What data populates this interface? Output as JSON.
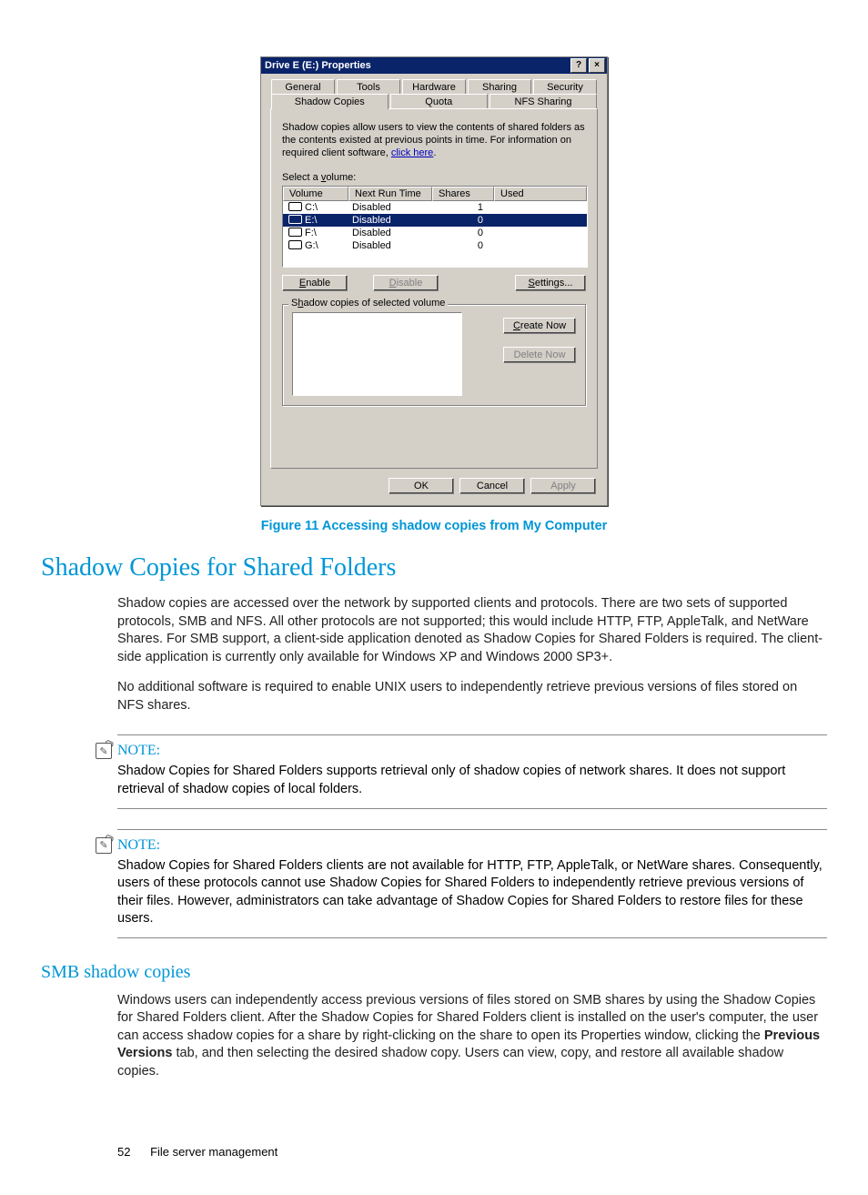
{
  "dialog": {
    "title": "Drive E (E:) Properties",
    "help_btn": "?",
    "close_btn": "×",
    "tabs_top": [
      "General",
      "Tools",
      "Hardware",
      "Sharing",
      "Security"
    ],
    "tabs_bottom": [
      "Shadow Copies",
      "Quota",
      "NFS Sharing"
    ],
    "desc_prefix": "Shadow copies allow users to view the contents of shared folders as the contents existed at previous points in time. For information on required client software, ",
    "desc_link": "click here",
    "desc_suffix": ".",
    "select_label_pre": "Select a ",
    "select_label_u": "v",
    "select_label_post": "olume:",
    "headers": {
      "volume": "Volume",
      "next_run": "Next Run Time",
      "shares": "Shares",
      "used": "Used"
    },
    "rows": [
      {
        "name": "C:\\",
        "next_run": "Disabled",
        "shares": "1",
        "used": ""
      },
      {
        "name": "E:\\",
        "next_run": "Disabled",
        "shares": "0",
        "used": "",
        "selected": true
      },
      {
        "name": "F:\\",
        "next_run": "Disabled",
        "shares": "0",
        "used": ""
      },
      {
        "name": "G:\\",
        "next_run": "Disabled",
        "shares": "0",
        "used": ""
      }
    ],
    "enable_btn_u": "E",
    "enable_btn_post": "nable",
    "disable_btn_u": "D",
    "disable_btn_post": "isable",
    "settings_btn_u": "S",
    "settings_btn_post": "ettings...",
    "fieldset_pre": "S",
    "fieldset_u": "h",
    "fieldset_post": "adow copies of selected volume",
    "create_btn_u": "C",
    "create_btn_post": "reate Now",
    "delete_btn": "Delete Now",
    "ok": "OK",
    "cancel": "Cancel",
    "apply": "Apply"
  },
  "figure_caption": "Figure 11 Accessing shadow copies from My Computer",
  "h1": "Shadow Copies for Shared Folders",
  "p1": "Shadow copies are accessed over the network by supported clients and protocols. There are two sets of supported protocols, SMB and NFS. All other protocols are not supported; this would include HTTP, FTP, AppleTalk, and NetWare Shares. For SMB support, a client-side application denoted as Shadow Copies for Shared Folders is required. The client-side application is currently only available for Windows XP and Windows 2000 SP3+.",
  "p2": "No additional software is required to enable UNIX users to independently retrieve previous versions of files stored on NFS shares.",
  "note_label": "NOTE:",
  "note1": "Shadow Copies for Shared Folders supports retrieval only of shadow copies of network shares. It does not support retrieval of shadow copies of local folders.",
  "note2": "Shadow Copies for Shared Folders clients are not available for HTTP, FTP, AppleTalk, or NetWare shares. Consequently, users of these protocols cannot use Shadow Copies for Shared Folders to independently retrieve previous versions of their files. However, administrators can take advantage of Shadow Copies for Shared Folders to restore files for these users.",
  "h2": "SMB shadow copies",
  "p3a": "Windows users can independently access previous versions of files stored on SMB shares by using the Shadow Copies for Shared Folders client. After the Shadow Copies for Shared Folders client is installed on the user's computer, the user can access shadow copies for a share by right-clicking on the share to open its Properties window, clicking the ",
  "p3_bold": "Previous Versions",
  "p3b": " tab, and then selecting the desired shadow copy. Users can view, copy, and restore all available shadow copies.",
  "footer": {
    "page": "52",
    "section": "File server management"
  }
}
